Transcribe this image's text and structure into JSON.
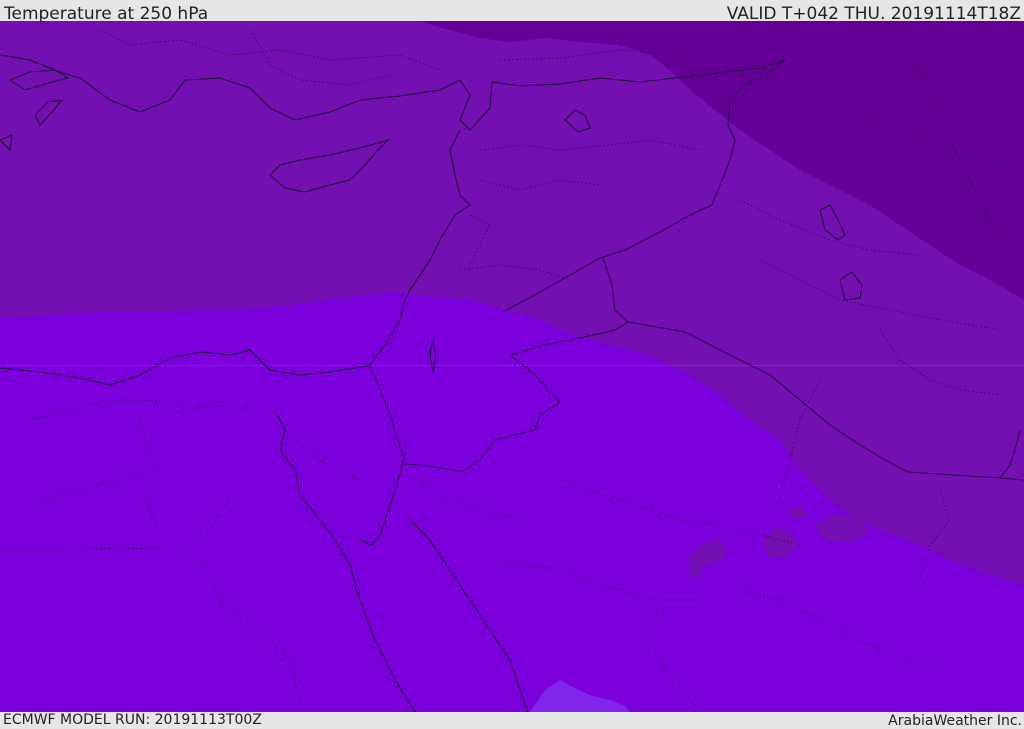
{
  "header": {
    "title": "Temperature at 250 hPa",
    "valid": "VALID T+042 THU. 20191114T18Z"
  },
  "footer": {
    "model_run": "ECMWF MODEL RUN: 20191113T00Z",
    "credit": "ArabiaWeather Inc."
  },
  "colors": {
    "band_warm": "#7b00db",
    "band_mid": "#7410b2",
    "band_cold": "#640096",
    "patch_warm": "#8025ea",
    "coast_line": "#1a1030",
    "border_line": "#240a48",
    "frame_bg": "#e6e6e6"
  }
}
